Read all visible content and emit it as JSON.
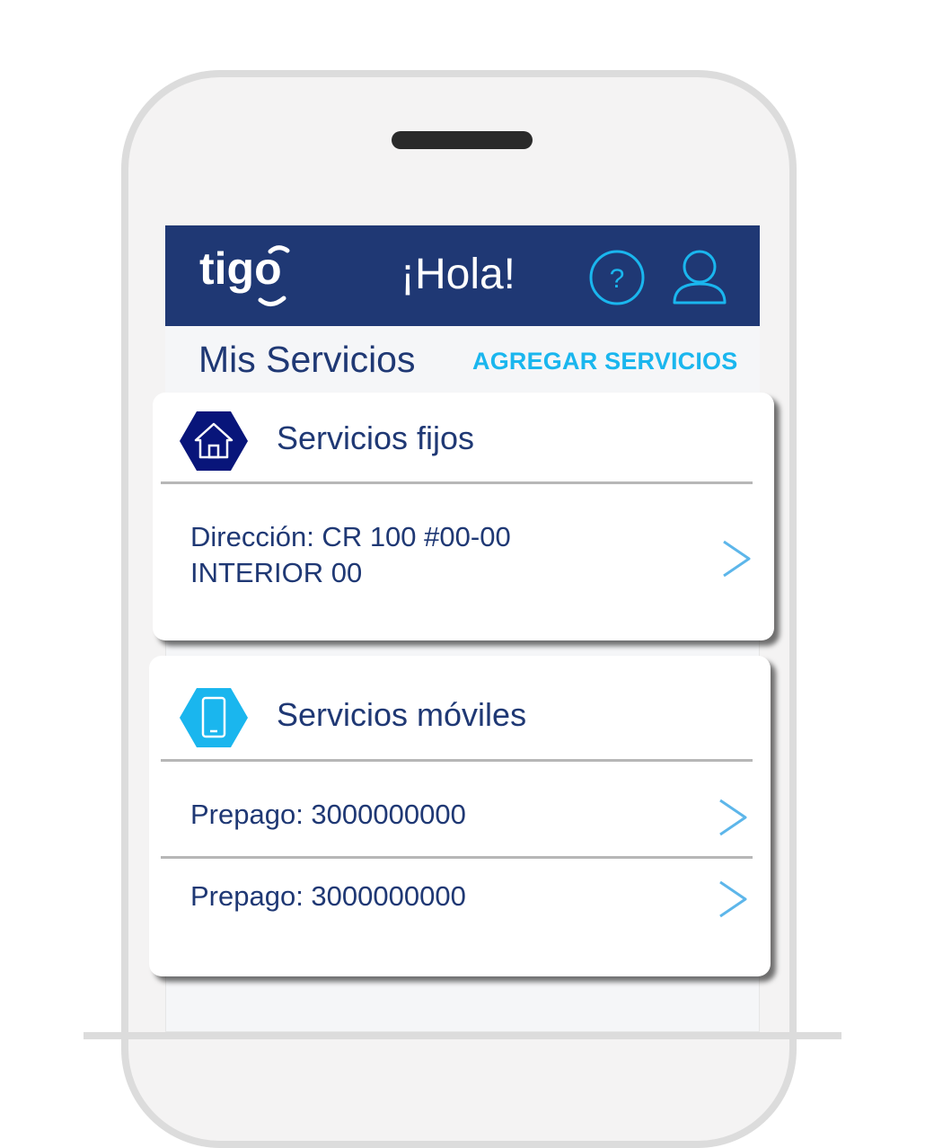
{
  "header": {
    "logo_text": "tigo",
    "greeting": "¡Hola!",
    "help_icon": "question-circle-icon",
    "user_icon": "user-icon"
  },
  "services_header": {
    "title": "Mis Servicios",
    "add_link": "AGREGAR SERVICIOS"
  },
  "fixed_services": {
    "icon": "house-icon",
    "title": "Servicios fijos",
    "items": [
      {
        "line1": "Dirección: CR 100 #00-00",
        "line2": "INTERIOR 00"
      }
    ]
  },
  "mobile_services": {
    "icon": "mobile-phone-icon",
    "title": "Servicios móviles",
    "items": [
      {
        "label": "Prepago: 3000000000"
      },
      {
        "label": "Prepago: 3000000000"
      }
    ]
  },
  "colors": {
    "header_bg": "#1f3874",
    "accent": "#1ab6ee",
    "text_primary": "#1f3874",
    "fixed_icon_bg": "#08157a",
    "mobile_icon_bg": "#1ab6ee"
  }
}
